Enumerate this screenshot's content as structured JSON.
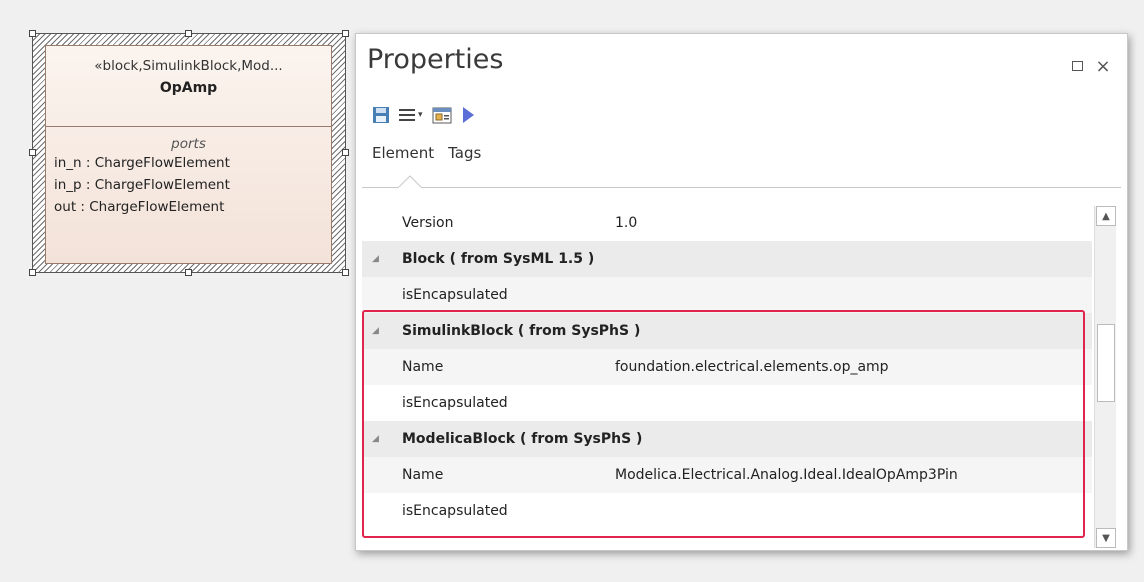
{
  "diagram": {
    "block": {
      "stereotype": "«block,SimulinkBlock,Mod...",
      "name": "OpAmp",
      "compartment_title": "ports",
      "ports": [
        "in_n : ChargeFlowElement",
        "in_p : ChargeFlowElement",
        "out : ChargeFlowElement"
      ]
    }
  },
  "properties": {
    "title": "Properties",
    "window_buttons": {
      "maximize": "maximize-icon",
      "close": "×"
    },
    "toolbar": [
      {
        "name": "save-icon"
      },
      {
        "name": "menu-icon",
        "caret": "▾"
      },
      {
        "name": "properties-dialog-icon"
      },
      {
        "name": "play-icon"
      }
    ],
    "tabs": [
      "Element",
      "Tags"
    ],
    "rows": [
      {
        "type": "prop",
        "key": "Version",
        "value": "1.0"
      },
      {
        "type": "group",
        "title": "Block  ( from SysML 1.5 )"
      },
      {
        "type": "prop",
        "key": "isEncapsulated",
        "value": ""
      },
      {
        "type": "group",
        "title": "SimulinkBlock  ( from SysPhS )"
      },
      {
        "type": "prop",
        "key": "Name",
        "value": "foundation.electrical.elements.op_amp"
      },
      {
        "type": "prop",
        "key": "isEncapsulated",
        "value": ""
      },
      {
        "type": "group",
        "title": "ModelicaBlock  ( from SysPhS )"
      },
      {
        "type": "prop",
        "key": "Name",
        "value": "Modelica.Electrical.Analog.Ideal.IdealOpAmp3Pin"
      },
      {
        "type": "prop",
        "key": "isEncapsulated",
        "value": ""
      }
    ]
  },
  "colors": {
    "highlight": "#e0244c",
    "block_fill": "#f3e2d8",
    "save_icon": "#4a7fb5",
    "play_icon": "#5b6fd6"
  }
}
